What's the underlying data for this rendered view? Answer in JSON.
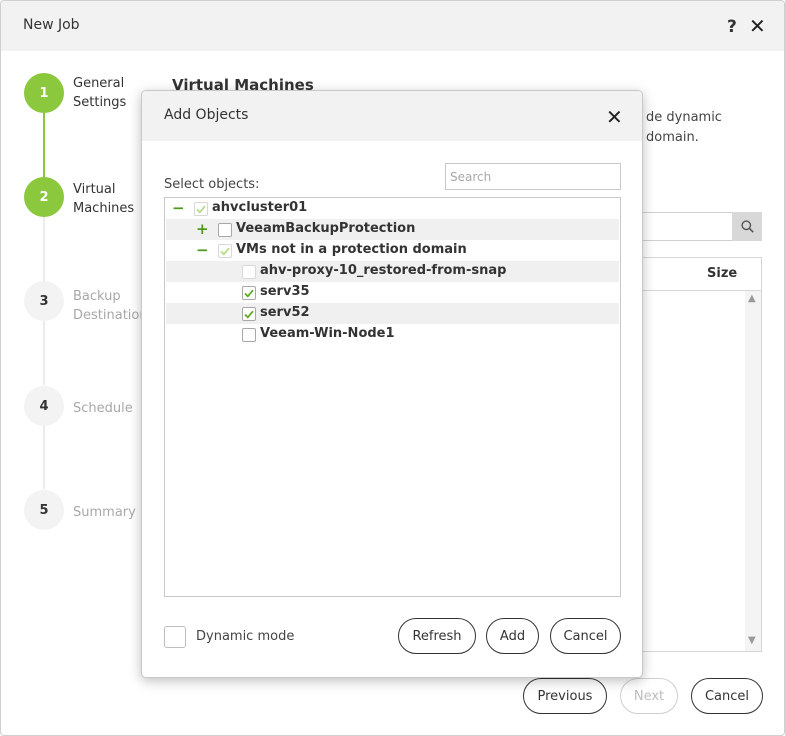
{
  "window": {
    "title": "New Job",
    "help_label": "?",
    "close_label": "✕"
  },
  "steps": [
    {
      "number": "1",
      "line1": "General",
      "line2": "Settings",
      "state": "done"
    },
    {
      "number": "2",
      "line1": "Virtual",
      "line2": "Machines",
      "state": "current"
    },
    {
      "number": "3",
      "line1": "Backup",
      "line2": "Destination",
      "state": "pending"
    },
    {
      "number": "4",
      "line1": "Schedule",
      "line2": "",
      "state": "pending"
    },
    {
      "number": "5",
      "line1": "Summary",
      "line2": "",
      "state": "pending"
    }
  ],
  "main": {
    "heading": "Virtual Machines",
    "desc_line1": "de dynamic",
    "desc_line2": "domain.",
    "table_size_header": "Size"
  },
  "footer": {
    "previous": "Previous",
    "next": "Next",
    "cancel": "Cancel"
  },
  "modal": {
    "title": "Add Objects",
    "close_label": "✕",
    "search_placeholder": "Search",
    "select_label": "Select objects:",
    "tree": [
      {
        "label": "ahvcluster01",
        "toggle": "−",
        "checked": true,
        "dim": true
      },
      {
        "label": "VeeamBackupProtection",
        "toggle": "+",
        "checked": false,
        "dim": false
      },
      {
        "label": "VMs not in a protection domain",
        "toggle": "−",
        "checked": true,
        "dim": true
      },
      {
        "label": "ahv-proxy-10_restored-from-snap",
        "toggle": "",
        "checked": false,
        "dim": true
      },
      {
        "label": "serv35",
        "toggle": "",
        "checked": true,
        "dim": false
      },
      {
        "label": "serv52",
        "toggle": "",
        "checked": true,
        "dim": false
      },
      {
        "label": "Veeam-Win-Node1",
        "toggle": "",
        "checked": false,
        "dim": false
      }
    ],
    "dynamic_mode_label": "Dynamic mode",
    "refresh": "Refresh",
    "add": "Add",
    "cancel": "Cancel"
  },
  "colors": {
    "accent_green": "#8bc83d",
    "tree_toggle_green": "#4e9a1f"
  },
  "icons": {
    "help": "question-mark-icon",
    "close": "close-icon",
    "search": "magnifier-icon",
    "check": "checkmark-icon"
  }
}
